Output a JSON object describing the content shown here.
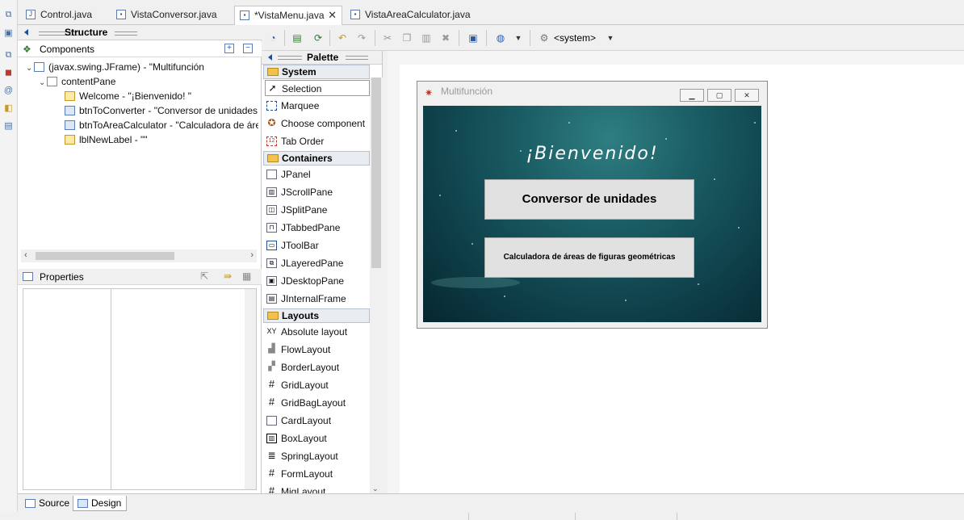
{
  "editor_tabs": [
    {
      "label": "Control.java",
      "icon": "java-file-icon"
    },
    {
      "label": "VistaConversor.java",
      "icon": "java-class-icon"
    },
    {
      "label": "*VistaMenu.java",
      "icon": "java-class-icon",
      "active": true
    },
    {
      "label": "VistaAreaCalculator.java",
      "icon": "java-class-icon"
    }
  ],
  "structure": {
    "title": "Structure",
    "components_label": "Components",
    "tree": [
      {
        "label": "(javax.swing.JFrame) - \"Multifunción",
        "level": 0
      },
      {
        "label": "contentPane",
        "level": 1
      },
      {
        "label": "Welcome - \"¡Bienvenido! \"",
        "level": 2
      },
      {
        "label": "btnToConverter - \"Conversor de unidades",
        "level": 2
      },
      {
        "label": "btnToAreaCalculator - \"Calculadora de áre",
        "level": 2
      },
      {
        "label": "lblNewLabel - \"\"",
        "level": 2
      }
    ],
    "properties_label": "Properties"
  },
  "toolbar": {
    "system_label": "<system>"
  },
  "palette": {
    "title": "Palette",
    "categories": {
      "system": "System",
      "containers": "Containers",
      "layouts": "Layouts"
    },
    "system_items": [
      "Selection",
      "Marquee",
      "Choose component",
      "Tab Order"
    ],
    "container_items": [
      "JPanel",
      "JScrollPane",
      "JSplitPane",
      "JTabbedPane",
      "JToolBar",
      "JLayeredPane",
      "JDesktopPane",
      "JInternalFrame"
    ],
    "layout_items": [
      "Absolute layout",
      "FlowLayout",
      "BorderLayout",
      "GridLayout",
      "GridBagLayout",
      "CardLayout",
      "BoxLayout",
      "SpringLayout",
      "FormLayout",
      "MigLayout"
    ]
  },
  "preview": {
    "window_title": "Multifunción",
    "welcome": "¡Bienvenido!",
    "btn_converter": "Conversor de unidades",
    "btn_area": "Calculadora de áreas de figuras geométricas"
  },
  "bottom_tabs": {
    "source": "Source",
    "design": "Design"
  },
  "colors": {
    "sea_top": "#2e7e82",
    "sea_bottom": "#07262f",
    "palette_category_bg": "#e9edf2",
    "folder_icon": "#f3c24a"
  }
}
